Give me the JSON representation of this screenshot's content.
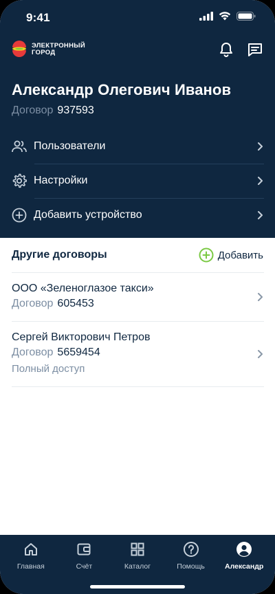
{
  "status": {
    "time": "9:41"
  },
  "brand": {
    "line1": "ЭЛЕКТРОННЫЙ",
    "line2": "ГОРОД"
  },
  "user": {
    "name": "Александр Олегович Иванов",
    "contract_label": "Договор",
    "contract_number": "937593"
  },
  "menu": [
    {
      "label": "Пользователи",
      "icon": "users-icon"
    },
    {
      "label": "Настройки",
      "icon": "gear-icon"
    },
    {
      "label": "Добавить устройство",
      "icon": "plus-circle-icon"
    }
  ],
  "other_contracts": {
    "title": "Другие договоры",
    "add_label": "Добавить",
    "items": [
      {
        "name": "ООО «Зеленоглазое такси»",
        "contract_label": "Договор",
        "contract_number": "605453",
        "access": ""
      },
      {
        "name": "Сергей Викторович Петров",
        "contract_label": "Договор",
        "contract_number": "5659454",
        "access": "Полный доступ"
      }
    ]
  },
  "tabs": [
    {
      "label": "Главная",
      "icon": "home-icon",
      "active": false
    },
    {
      "label": "Счёт",
      "icon": "wallet-icon",
      "active": false
    },
    {
      "label": "Каталог",
      "icon": "catalog-icon",
      "active": false
    },
    {
      "label": "Помощь",
      "icon": "help-icon",
      "active": false
    },
    {
      "label": "Александр",
      "icon": "profile-icon",
      "active": true
    }
  ],
  "colors": {
    "navy": "#0f2740",
    "accent_green": "#7ac943",
    "muted": "#7c8ea3",
    "logo_red": "#e63a3a",
    "logo_yellow": "#f4d21f"
  }
}
